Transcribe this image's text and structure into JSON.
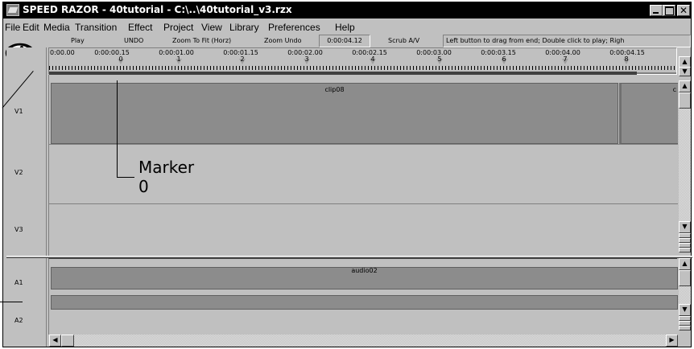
{
  "window": {
    "title": "SPEED RAZOR - 40tutorial - C:\\..\\40tutorial_v3.rzx",
    "minimize_icon": "minimize-icon",
    "maximize_icon": "maximize-icon",
    "close_label": "✕"
  },
  "menu": [
    {
      "label": "File"
    },
    {
      "label": "Edit"
    },
    {
      "label": "Media"
    },
    {
      "label": "Transition"
    },
    {
      "label": "Effect"
    },
    {
      "label": "Project"
    },
    {
      "label": "View"
    },
    {
      "label": "Library"
    },
    {
      "label": "Preferences"
    },
    {
      "label": "Help"
    }
  ],
  "toolbar": {
    "play": "Play",
    "undo": "UNDO",
    "zoom_fit": "Zoom To Fit (Horz)",
    "zoom_undo": "Zoom Undo",
    "timecode": "0:00:04.12",
    "scrub": "Scrub A/V",
    "status": "Left button to drag from end; Double click to play; Righ"
  },
  "ruler": {
    "ticks": [
      "0:00.00",
      "0:00:00.15",
      "0:00:01.00",
      "0:00:01.15",
      "0:00:02.00",
      "0:00:02.15",
      "0:00:03.00",
      "0:00:03.15",
      "0:00:04.00",
      "0:00:04.15"
    ],
    "markers": [
      "0",
      "1",
      "2",
      "3",
      "4",
      "5",
      "6",
      "7",
      "8"
    ]
  },
  "tracks": {
    "video": [
      "V1",
      "V2",
      "V3"
    ],
    "audio": [
      "A1",
      "A2"
    ]
  },
  "clips": {
    "video_clip": "clip08",
    "video_clip_next": "c",
    "audio_clip": "audio02"
  },
  "annotation": {
    "marker_line1": "Marker",
    "marker_line2": "0"
  }
}
